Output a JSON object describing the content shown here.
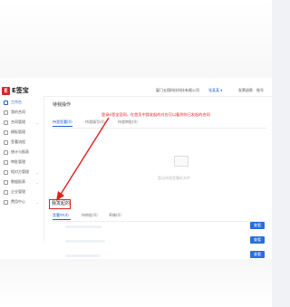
{
  "header": {
    "logo_mark": "E",
    "logo_text": "E签宝",
    "company": "厦门五翔科技科技有限公司",
    "user": "张某某 ▾",
    "link_1": "发票退款",
    "link_2": "账号"
  },
  "sidebar": {
    "items": [
      {
        "label": "工作台",
        "active": true,
        "chevron": ""
      },
      {
        "label": "我的合同",
        "active": false,
        "chevron": ""
      },
      {
        "label": "合同管理",
        "active": false,
        "chevron": "⌄"
      },
      {
        "label": "模板管理",
        "active": false,
        "chevron": ""
      },
      {
        "label": "签署流程",
        "active": false,
        "chevron": ""
      },
      {
        "label": "统计与报表",
        "active": false,
        "chevron": ""
      },
      {
        "label": "审批管理",
        "active": false,
        "chevron": ""
      },
      {
        "label": "相对方管理",
        "active": false,
        "chevron": "⌄"
      },
      {
        "label": "数据报表",
        "active": false,
        "chevron": "⌄"
      },
      {
        "label": "企业管理",
        "active": false,
        "chevron": ""
      },
      {
        "label": "费用中心",
        "active": false,
        "chevron": "⌄"
      }
    ]
  },
  "main": {
    "todo_title": "待我操作",
    "todo_tabs": [
      "待我签署(0)",
      "待我填写(0)",
      "待我审批(0)"
    ],
    "empty_text": "暂无待我签署的文件",
    "sent_title": "我发起的",
    "sent_tabs": [
      "签署中(4)",
      "待审批(0)",
      "草稿(0)"
    ],
    "view_button": "查看"
  },
  "annotation": {
    "text": "登录e签宝官网，在首页中我发起的对应可以看到你已发起的合同",
    "color": "#e02020"
  },
  "colors": {
    "accent": "#1f63c6",
    "brand": "#d8262e",
    "button": "#2a6fdb"
  }
}
